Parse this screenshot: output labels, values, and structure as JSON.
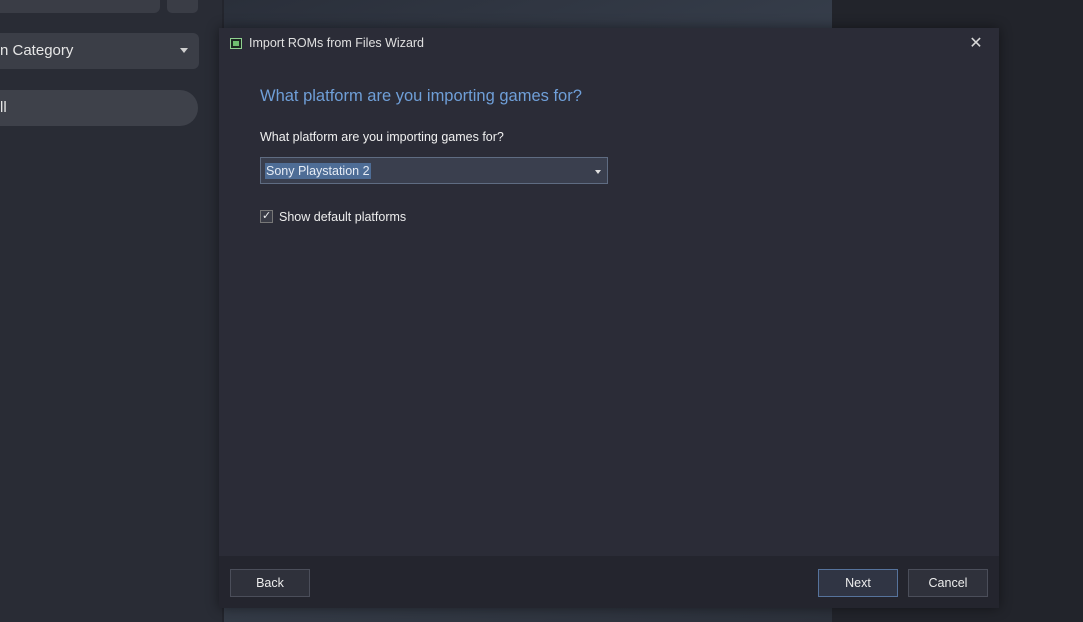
{
  "background": {
    "category_label": "n Category",
    "all_label": "ll"
  },
  "dialog": {
    "title": "Import ROMs from Files Wizard",
    "close_symbol": "✕",
    "heading": "What platform are you importing games for?",
    "platform_label": "What platform are you importing games for?",
    "platform_selected": "Sony Playstation 2",
    "show_default_label": "Show default platforms",
    "show_default_checked": true,
    "check_symbol": "✓",
    "buttons": {
      "back": "Back",
      "next": "Next",
      "cancel": "Cancel"
    }
  },
  "colors": {
    "heading": "#6f9fd8",
    "dialog_bg": "#2b2c37",
    "footer_bg": "#24252e",
    "selection": "#4e6d96"
  }
}
